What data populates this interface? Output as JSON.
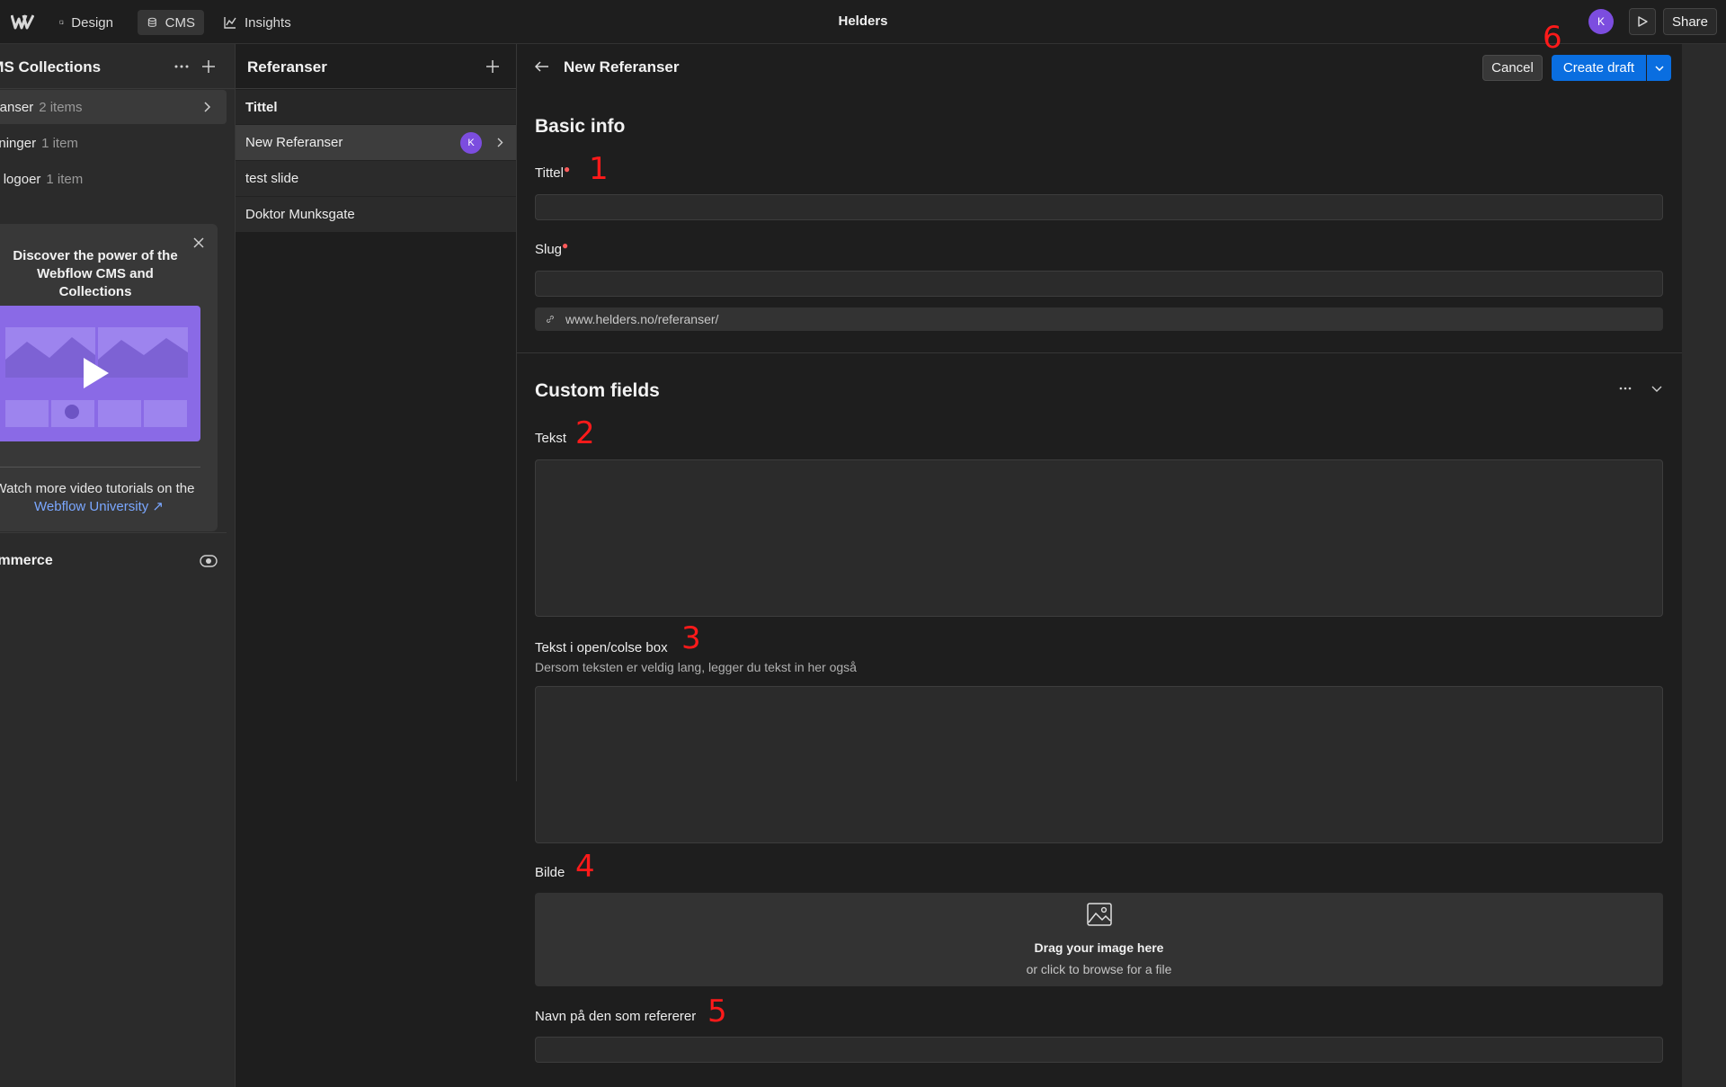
{
  "topbar": {
    "tabs": [
      {
        "label": "Design",
        "icon": "cursor-square-icon"
      },
      {
        "label": "CMS",
        "icon": "database-icon"
      },
      {
        "label": "Insights",
        "icon": "line-chart-icon"
      }
    ],
    "site_title": "Helders",
    "avatar_initial": "K",
    "share_label": "Share"
  },
  "collections": {
    "title": "CMS Collections",
    "items": [
      {
        "name": "Referanser",
        "count": "2 items"
      },
      {
        "name": "Brukerveiledninger",
        "count": "1 item"
      },
      {
        "name": "Forhandler logoer",
        "count": "1 item"
      }
    ],
    "promo": {
      "title": "Discover the power of the Webflow CMS and Collections",
      "watch_text": "Watch more video tutorials on the",
      "link_text": "Webflow University ↗"
    },
    "ecommerce_label": "Ecommerce"
  },
  "items_list": {
    "title": "Referanser",
    "column_header": "Tittel",
    "rows": [
      {
        "title": "New Referanser",
        "avatar": "K"
      },
      {
        "title": "test slide"
      },
      {
        "title": "Doktor Munksgate"
      }
    ]
  },
  "form": {
    "title": "New Referanser",
    "cancel_label": "Cancel",
    "create_label": "Create draft",
    "basic_title": "Basic info",
    "tittel_label": "Tittel",
    "tittel_value": "",
    "slug_label": "Slug",
    "slug_value": "",
    "slug_prefix": "www.helders.no/referanser/",
    "custom_title": "Custom fields",
    "tekst_label": "Tekst",
    "tekst_value": "",
    "openclose_label": "Tekst i open/colse box",
    "openclose_help": "Dersom teksten er veldig lang, legger du tekst in her også",
    "openclose_value": "",
    "bilde_label": "Bilde",
    "drop_title": "Drag your image here",
    "drop_sub": "or click to browse for a file",
    "navn_label": "Navn på den som refererer",
    "navn_value": ""
  },
  "annotations": [
    "1",
    "2",
    "3",
    "4",
    "5",
    "6"
  ],
  "colors": {
    "accent_blue": "#0a6ee0",
    "avatar_purple": "#7c4ddf",
    "annotation_red": "#ff1a1a",
    "link_blue": "#7aa7ff"
  }
}
